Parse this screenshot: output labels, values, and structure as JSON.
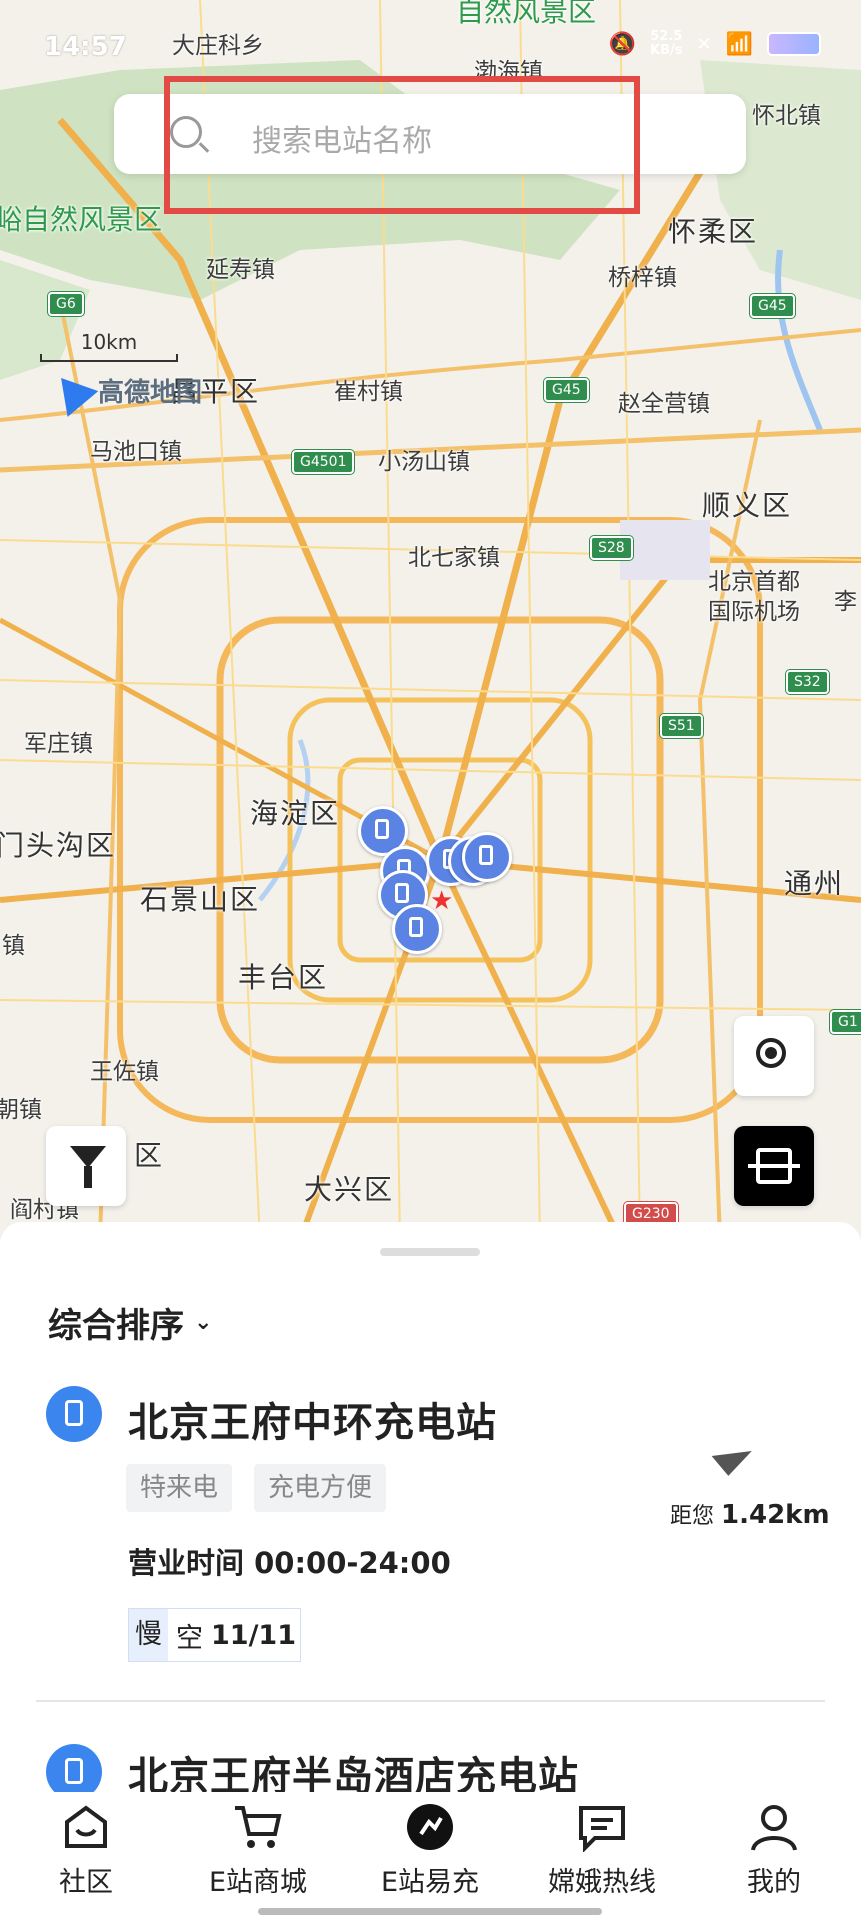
{
  "status_bar": {
    "time": "14:57",
    "net_speed": "52.5",
    "net_unit": "KB/s"
  },
  "search": {
    "placeholder": "搜索电站名称"
  },
  "map": {
    "scale_label": "10km",
    "brand": "高德地图",
    "labels": [
      {
        "text": "大庄科乡"
      },
      {
        "text": "自然风景区"
      },
      {
        "text": "渤海镇"
      },
      {
        "text": "怀北镇"
      },
      {
        "text": "峪自然风景区"
      },
      {
        "text": "怀柔区"
      },
      {
        "text": "延寿镇"
      },
      {
        "text": "桥梓镇"
      },
      {
        "text": "昌平区"
      },
      {
        "text": "崔村镇"
      },
      {
        "text": "赵全营镇"
      },
      {
        "text": "马池口镇"
      },
      {
        "text": "小汤山镇"
      },
      {
        "text": "顺义区"
      },
      {
        "text": "北七家镇"
      },
      {
        "text": "北京首都"
      },
      {
        "text": "国际机场"
      },
      {
        "text": "李"
      },
      {
        "text": "军庄镇"
      },
      {
        "text": "海淀区"
      },
      {
        "text": "门头沟区"
      },
      {
        "text": "通州"
      },
      {
        "text": "石景山区"
      },
      {
        "text": "镇"
      },
      {
        "text": "丰台区"
      },
      {
        "text": "王佐镇"
      },
      {
        "text": "朝镇"
      },
      {
        "text": "区"
      },
      {
        "text": "大兴区"
      },
      {
        "text": "阎村镇"
      }
    ],
    "shields": [
      "G6",
      "G45",
      "G45",
      "G4501",
      "S28",
      "S32",
      "S51",
      "G230",
      "G1"
    ]
  },
  "list": {
    "sort_label": "综合排序",
    "stations": [
      {
        "name": "北京王府中环充电站",
        "tags": [
          "特来电",
          "充电方便"
        ],
        "distance_prefix": "距您",
        "distance": "1.42km",
        "hours": "营业时间 00:00-24:00",
        "slot_type": "慢",
        "slot_status": "空",
        "slot_count": "11/11"
      },
      {
        "name": "北京王府半岛酒店充电站"
      }
    ]
  },
  "tabs": [
    {
      "label": "社区",
      "icon": "home-icon"
    },
    {
      "label": "E站商城",
      "icon": "cart-icon"
    },
    {
      "label": "E站易充",
      "icon": "charge-icon"
    },
    {
      "label": "嫦娥热线",
      "icon": "chat-icon"
    },
    {
      "label": "我的",
      "icon": "user-icon"
    }
  ]
}
